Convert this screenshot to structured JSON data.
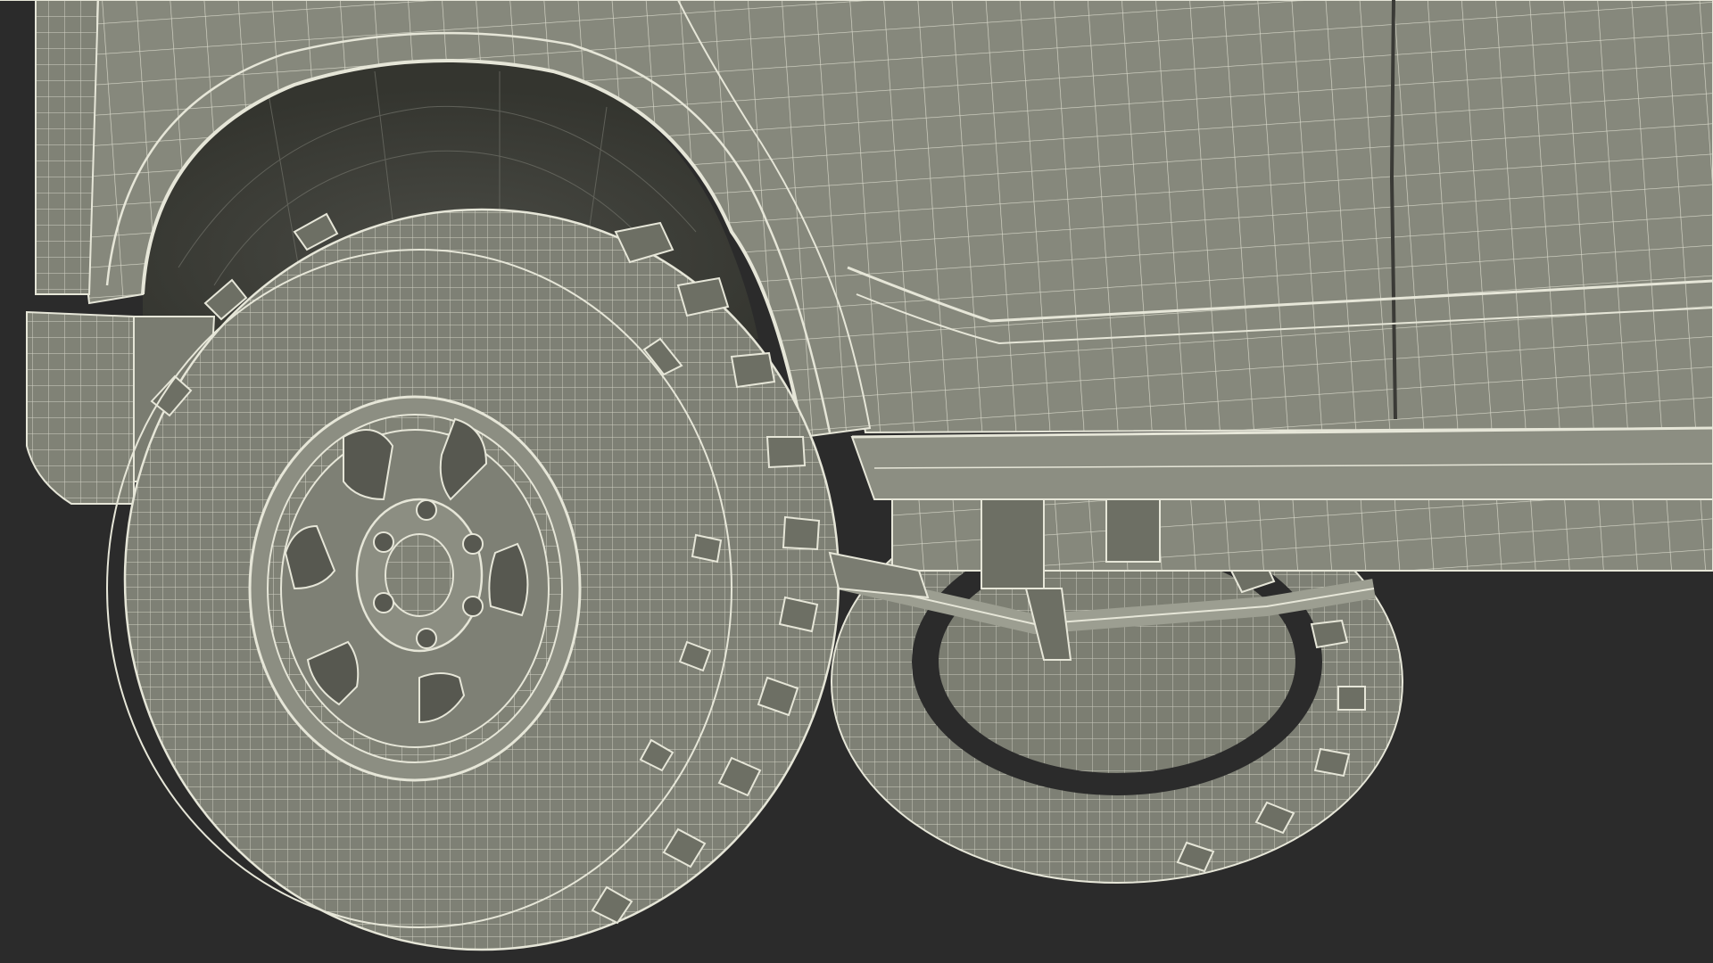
{
  "viewport": {
    "background_color": "#2b2b2b",
    "subject": "vehicle-wireframe-render",
    "colors": {
      "surface": "#86887c",
      "surface_light": "#9c9e91",
      "surface_dark": "#6d6f64",
      "wire": "#e6e6d8",
      "shadow": "#3a3a36",
      "tire": "#7e8075",
      "tire_dark": "#5e6057",
      "hub_dark": "#575850"
    },
    "elements": [
      "body-panel",
      "fender-flare",
      "wheel-arch",
      "door-seam",
      "rocker-panel",
      "underbody-frame",
      "bumper",
      "front-tire",
      "front-wheel-rim",
      "lug-nuts",
      "rear-tire",
      "axle-suspension"
    ]
  }
}
